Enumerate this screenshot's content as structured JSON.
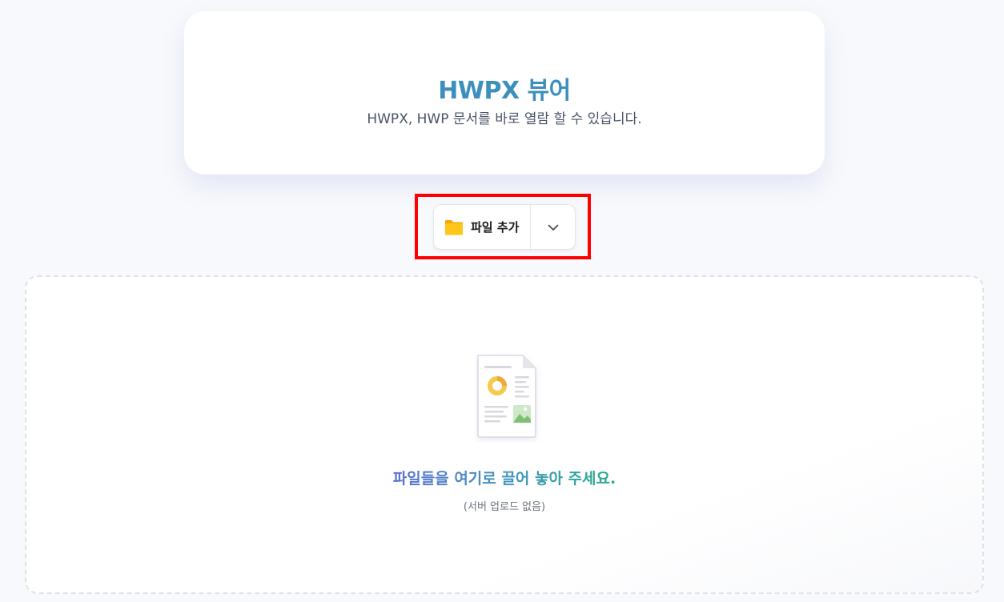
{
  "header": {
    "title": "HWPX 뷰어",
    "subtitle": "HWPX, HWP 문서를 바로 열람 할 수 있습니다."
  },
  "toolbar": {
    "file_add_label": "파일 추가",
    "file_add_icon": "folder-icon",
    "dropdown_icon": "chevron-down-icon"
  },
  "dropzone": {
    "icon": "document-icon",
    "prompt": "파일들을 여기로 끌어 놓아 주세요.",
    "note": "(서버 업로드 없음)"
  },
  "colors": {
    "title": "#3d8fbd",
    "highlight": "#ff0000",
    "folder": "#ffc107",
    "prompt_gradient": [
      "#5b6fd6",
      "#3f97b8",
      "#2aab8c"
    ]
  }
}
